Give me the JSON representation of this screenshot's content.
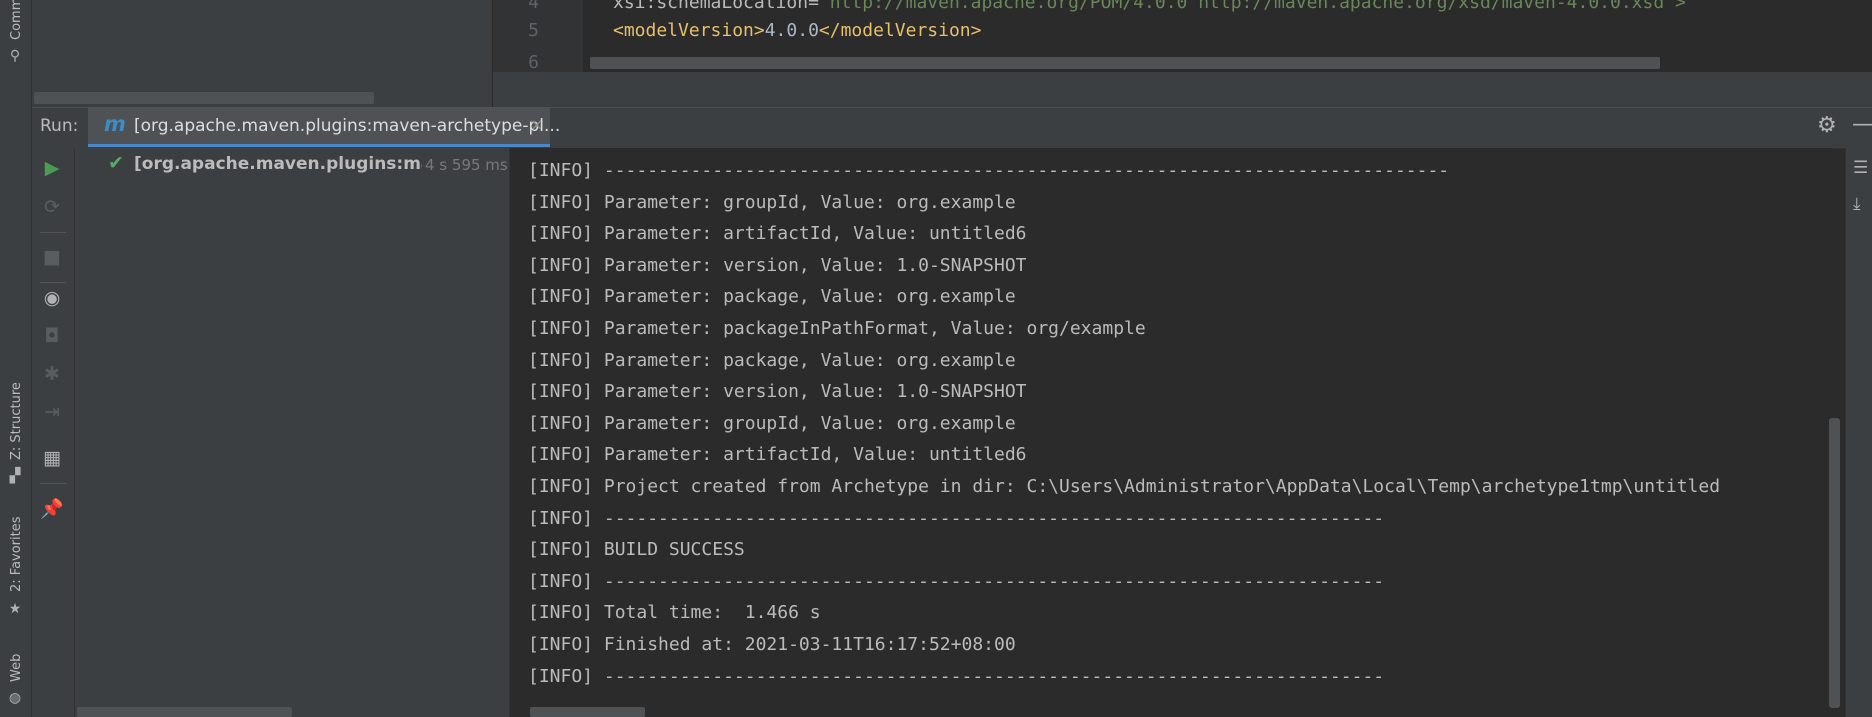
{
  "left_strip": {
    "tabs": [
      {
        "label": "Comm",
        "icon": "commit-icon"
      },
      {
        "label": "Z: Structure",
        "icon": "structure-icon"
      },
      {
        "label": "2: Favorites",
        "icon": "star-icon"
      },
      {
        "label": "Web",
        "icon": "web-globe-icon"
      }
    ]
  },
  "editor": {
    "lines": [
      {
        "number": "4",
        "attr": "xsi:schemaLocation=",
        "value": "\"http://maven.apache.org/POM/4.0.0 http://maven.apache.org/xsd/maven-4.0.0.xsd\">"
      },
      {
        "number": "5",
        "open_tag": "<modelVersion>",
        "text": "4.0.0",
        "close_tag": "</modelVersion>"
      },
      {
        "number": "6"
      }
    ]
  },
  "run_window": {
    "label": "Run:",
    "tab": {
      "icon": "maven-icon",
      "icon_glyph": "m",
      "title": "[org.apache.maven.plugins:maven-archetype-pl...",
      "close": "×"
    },
    "header_icons": [
      "gear-icon",
      "minimize-icon"
    ]
  },
  "toolbar": {
    "buttons": [
      "rerun-icon",
      "rerun-failed-icon",
      "stop-icon",
      "show-view-icon",
      "snapshot-icon",
      "debug-icon",
      "exit-icon",
      "layout-icon",
      "pin-icon"
    ]
  },
  "tree": {
    "item": {
      "label": "[org.apache.maven.plugins:maver",
      "time": "4 s 595 ms",
      "status": "success"
    }
  },
  "console": {
    "lines": [
      "[INFO] ------------------------------------------------------------------------------",
      "[INFO] Parameter: groupId, Value: org.example",
      "[INFO] Parameter: artifactId, Value: untitled6",
      "[INFO] Parameter: version, Value: 1.0-SNAPSHOT",
      "[INFO] Parameter: package, Value: org.example",
      "[INFO] Parameter: packageInPathFormat, Value: org/example",
      "[INFO] Parameter: package, Value: org.example",
      "[INFO] Parameter: version, Value: 1.0-SNAPSHOT",
      "[INFO] Parameter: groupId, Value: org.example",
      "[INFO] Parameter: artifactId, Value: untitled6",
      "[INFO] Project created from Archetype in dir: C:\\Users\\Administrator\\AppData\\Local\\Temp\\archetype1tmp\\untitled",
      "[INFO] ------------------------------------------------------------------------",
      "[INFO] BUILD SUCCESS",
      "[INFO] ------------------------------------------------------------------------",
      "[INFO] Total time:  1.466 s",
      "[INFO] Finished at: 2021-03-11T16:17:52+08:00",
      "[INFO] ------------------------------------------------------------------------"
    ]
  },
  "colors": {
    "background": "#2b2b2b",
    "panel": "#3c3f41",
    "accent": "#4a88c7",
    "success": "#59a869",
    "run_green": "#499c54"
  }
}
